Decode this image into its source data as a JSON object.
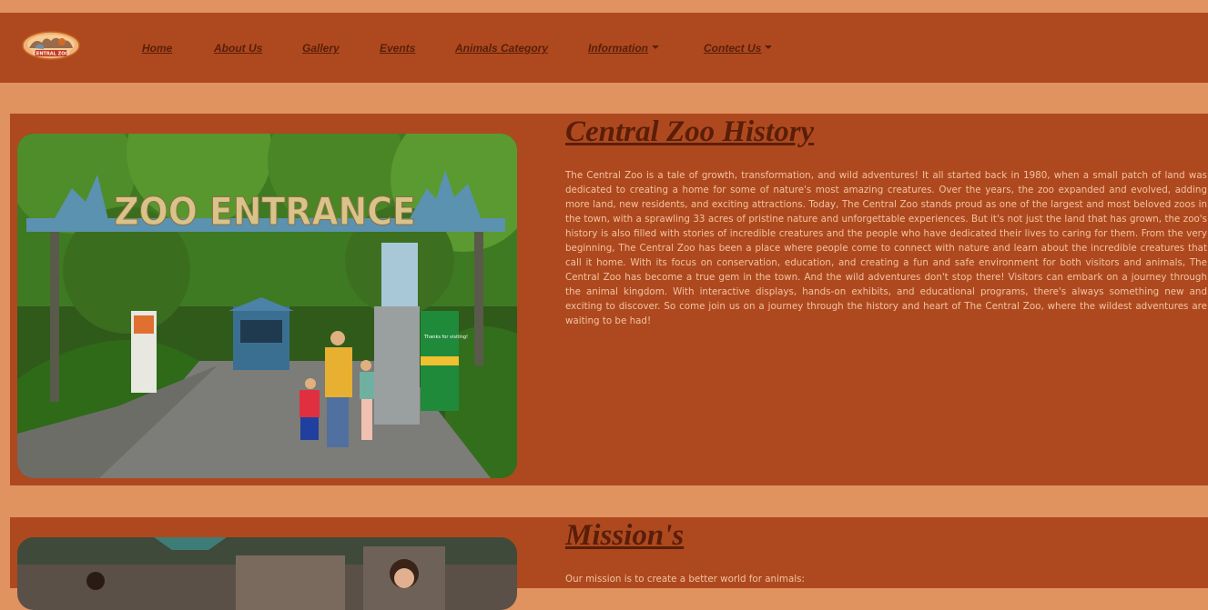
{
  "logo": {
    "text": "CENTRAL ZOO"
  },
  "nav": {
    "items": [
      {
        "label": "Home"
      },
      {
        "label": "About Us"
      },
      {
        "label": "Gallery"
      },
      {
        "label": "Events"
      },
      {
        "label": "Animals Category"
      },
      {
        "label": "Information"
      },
      {
        "label": "Contect Us"
      }
    ]
  },
  "history": {
    "title": "Central Zoo History",
    "body": "The Central Zoo is a tale of growth, transformation, and wild adventures! It all started back in 1980, when a small patch of land was dedicated to creating a home for some of nature's most amazing creatures. Over the years, the zoo expanded and evolved, adding more land, new residents, and exciting attractions. Today, The Central Zoo stands proud as one of the largest and most beloved zoos in the town, with a sprawling 33 acres of pristine nature and unforgettable experiences. But it's not just the land that has grown, the zoo's history is also filled with stories of incredible creatures and the people who have dedicated their lives to caring for them. From the very beginning, The Central Zoo has been a place where people come to connect with nature and learn about the incredible creatures that call it home. With its focus on conservation, education, and creating a fun and safe environment for both visitors and animals, The Central Zoo has become a true gem in the town. And the wild adventures don't stop there! Visitors can embark on a journey through the animal kingdom. With interactive displays, hands-on exhibits, and educational programs, there's always something new and exciting to discover. So come join us on a journey through the history and heart of The Central Zoo, where the wildest adventures are waiting to be had!",
    "image": {
      "sign_text": "ZOO ENTRANCE",
      "kiosk_text": "Thanks for visiting!"
    }
  },
  "mission": {
    "title": "Mission's",
    "body": "Our mission is to create a better world for animals:"
  },
  "colors": {
    "page_bg": "#e0925f",
    "panel_bg": "#ae491f",
    "link": "#5a1e08",
    "body_text": "#f2c2a0"
  }
}
